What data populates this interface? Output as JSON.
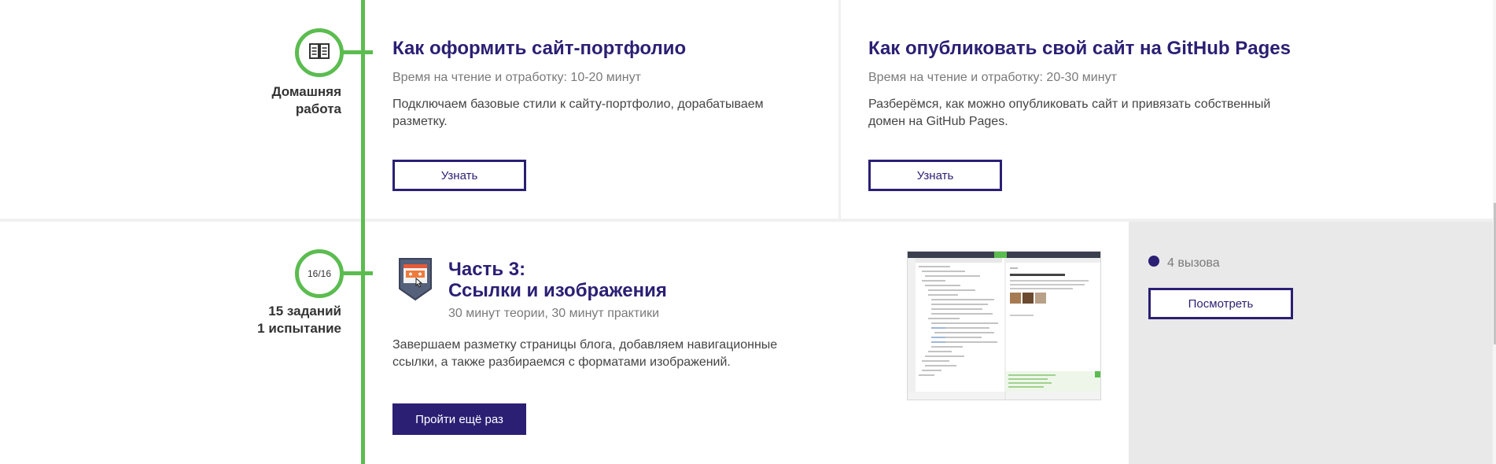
{
  "homework": {
    "label_line1": "Домашняя",
    "label_line2": "работа",
    "cards": [
      {
        "title": "Как оформить сайт-портфолио",
        "meta": "Время на чтение и отработку: 10-20 минут",
        "description": "Подключаем базовые стили к сайту-портфолио, дорабатываем разметку.",
        "button": "Узнать"
      },
      {
        "title": "Как опубликовать свой сайт на GitHub Pages",
        "meta": "Время на чтение и отработку: 20-30 минут",
        "description": "Разберёмся, как можно опубликовать сайт и привязать собственный домен на GitHub Pages.",
        "button": "Узнать"
      }
    ],
    "icon": "book-icon"
  },
  "part3": {
    "progress": "16/16",
    "progress_done": 16,
    "progress_total": 16,
    "label_line1": "15 заданий",
    "label_line2": "1 испытание",
    "title_line1": "Часть 3:",
    "title_line2": "Ссылки и изображения",
    "meta": "30 минут теории, 30 минут практики",
    "description": "Завершаем разметку страницы блога, добавляем навигационные ссылки, а также разбираемся с форматами изображений.",
    "button": "Пройти ещё раз",
    "badge_icon": "browser-badge-icon",
    "preview_icon": "code-editor-preview-icon"
  },
  "challenges": {
    "count_text": "4 вызова",
    "button": "Посмотреть"
  },
  "colors": {
    "accent": "#2b1f74",
    "green": "#5bbc4f"
  }
}
